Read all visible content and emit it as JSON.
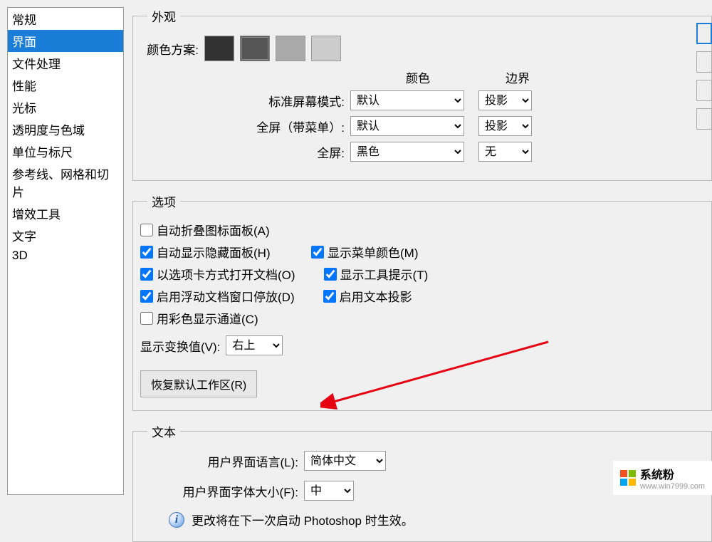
{
  "sidebar": {
    "items": [
      {
        "label": "常规"
      },
      {
        "label": "界面"
      },
      {
        "label": "文件处理"
      },
      {
        "label": "性能"
      },
      {
        "label": "光标"
      },
      {
        "label": "透明度与色域"
      },
      {
        "label": "单位与标尺"
      },
      {
        "label": "参考线、网格和切片"
      },
      {
        "label": "增效工具"
      },
      {
        "label": "文字"
      },
      {
        "label": "3D"
      }
    ],
    "selected_index": 1
  },
  "appearance": {
    "legend": "外观",
    "color_scheme_label": "颜色方案:",
    "color_header": "颜色",
    "border_header": "边界",
    "modes": [
      {
        "label": "标准屏幕模式:",
        "color_value": "默认",
        "border_value": "投影"
      },
      {
        "label": "全屏（带菜单）:",
        "color_value": "默认",
        "border_value": "投影"
      },
      {
        "label": "全屏:",
        "color_value": "黑色",
        "border_value": "无"
      }
    ]
  },
  "options": {
    "legend": "选项",
    "rows": [
      [
        {
          "label": "自动折叠图标面板(A)",
          "checked": false
        }
      ],
      [
        {
          "label": "自动显示隐藏面板(H)",
          "checked": true
        },
        {
          "label": "显示菜单颜色(M)",
          "checked": true
        }
      ],
      [
        {
          "label": "以选项卡方式打开文档(O)",
          "checked": true
        },
        {
          "label": "显示工具提示(T)",
          "checked": true
        }
      ],
      [
        {
          "label": "启用浮动文档窗口停放(D)",
          "checked": true
        },
        {
          "label": "启用文本投影",
          "checked": true
        }
      ],
      [
        {
          "label": "用彩色显示通道(C)",
          "checked": false
        }
      ]
    ],
    "display_transform_label": "显示变换值(V):",
    "display_transform_value": "右上",
    "restore_button": "恢复默认工作区(R)"
  },
  "text": {
    "legend": "文本",
    "ui_language_label": "用户界面语言(L):",
    "ui_language_value": "简体中文",
    "ui_font_size_label": "用户界面字体大小(F):",
    "ui_font_size_value": "中",
    "info_message": "更改将在下一次启动 Photoshop 时生效。"
  },
  "watermark": {
    "text": "系统粉",
    "url": "www.win7999.com"
  }
}
